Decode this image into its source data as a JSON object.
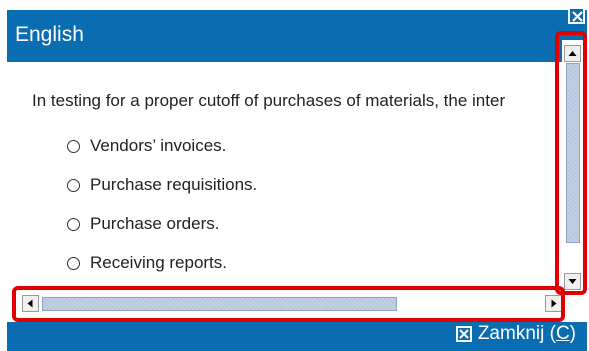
{
  "dialog": {
    "title": "English",
    "question_text": "In testing for a proper cutoff of purchases of materials, the inter",
    "options": [
      {
        "label": "Vendors’ invoices."
      },
      {
        "label": "Purchase requisitions."
      },
      {
        "label": "Purchase orders."
      },
      {
        "label": "Receiving reports."
      }
    ],
    "close_label_prefix": "Zamknij (",
    "close_label_key": "C",
    "close_label_suffix": ")"
  },
  "colors": {
    "header_blue": "#0b6db1",
    "highlight_red": "#e00000",
    "scroll_thumb": "#c3d0e3"
  },
  "icons": {
    "top_close": "close-icon",
    "footer_close": "close-box-icon",
    "scroll_up": "triangle-up-icon",
    "scroll_down": "triangle-down-icon",
    "scroll_left": "triangle-left-icon",
    "scroll_right": "triangle-right-icon"
  }
}
